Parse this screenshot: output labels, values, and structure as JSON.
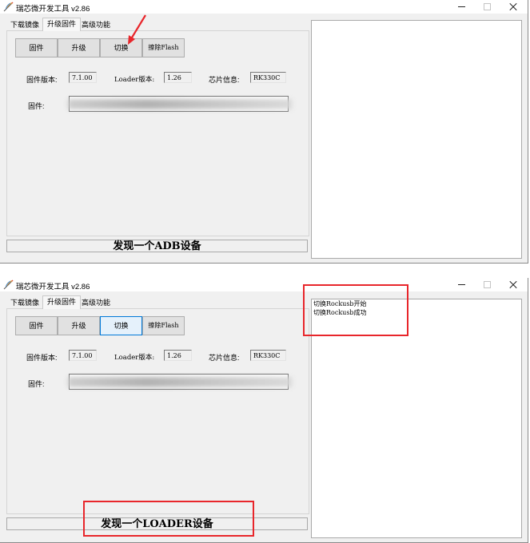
{
  "windows": [
    {
      "title": "瑞芯微开发工具 v2.86",
      "tabs": [
        "下载镜像",
        "升级固件",
        "高级功能"
      ],
      "buttons": [
        "固件",
        "升级",
        "切换",
        "擦除Flash"
      ],
      "fw_version_label": "固件版本:",
      "fw_version_value": "7.1.00",
      "loader_label": "Loader版本:",
      "loader_value": "1.26",
      "chip_label": "芯片信息:",
      "chip_value": "RK330C",
      "firmware_label": "固件:",
      "status": "发现一个ADB设备",
      "log": []
    },
    {
      "title": "瑞芯微开发工具 v2.86",
      "tabs": [
        "下载镜像",
        "升级固件",
        "高级功能"
      ],
      "buttons": [
        "固件",
        "升级",
        "切换",
        "擦除Flash"
      ],
      "fw_version_label": "固件版本:",
      "fw_version_value": "7.1.00",
      "loader_label": "Loader版本:",
      "loader_value": "1.26",
      "chip_label": "芯片信息:",
      "chip_value": "RK330C",
      "firmware_label": "固件:",
      "status": "发现一个LOADER设备",
      "log": [
        "切换Rockusb开始",
        "切换Rockusb成功"
      ]
    }
  ],
  "colors": {
    "window_bg": "#f0f0f0",
    "annotation_red": "#e8262b",
    "focus_blue": "#0078d7"
  },
  "icons": {
    "app": "feather-pen-icon",
    "minimize": "minimize-icon",
    "maximize": "maximize-icon",
    "close": "close-icon"
  }
}
